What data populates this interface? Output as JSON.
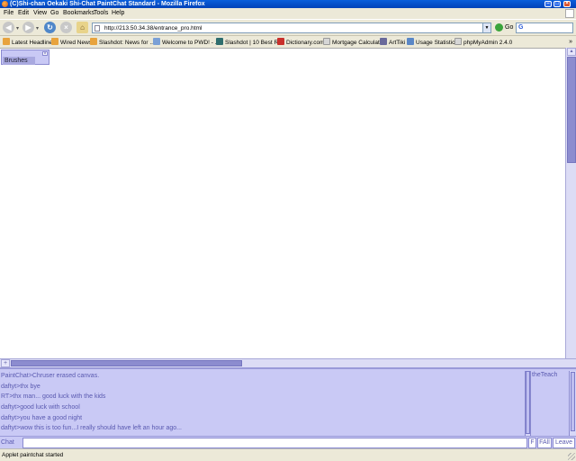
{
  "window": {
    "title": "(C)Shi-chan Oekaki Shi-Chat PaintChat Standard - Mozilla Firefox"
  },
  "menu": [
    "File",
    "Edit",
    "View",
    "Go",
    "Bookmarks",
    "Tools",
    "Help"
  ],
  "nav": {
    "url": "http://213.50.34.38/entrance_pro.html",
    "go_label": "Go",
    "search_value": ""
  },
  "bookmarks": [
    {
      "label": "Latest Headlines",
      "icon": "rss-icon",
      "color": "#e8a33d"
    },
    {
      "label": "Wired News",
      "icon": "rss-icon",
      "color": "#e8a33d"
    },
    {
      "label": "Slashdot: News for ...",
      "icon": "rss-icon",
      "color": "#e8a33d"
    },
    {
      "label": "Welcome to PWD! - ...",
      "icon": "page-icon",
      "color": "#7ba0d6"
    },
    {
      "label": "Slashdot | 10 Best R...",
      "icon": "slashdot-icon",
      "color": "#2f6e6e"
    },
    {
      "label": "Dictionary.com",
      "icon": "dictionary-icon",
      "color": "#c9302c"
    },
    {
      "label": "Mortgage Calculator",
      "icon": "page-icon",
      "color": "#d6d6d6"
    },
    {
      "label": "ArtTiki",
      "icon": "arttiki-icon",
      "color": "#6a6a9a"
    },
    {
      "label": "Usage Statistics",
      "icon": "stats-icon",
      "color": "#5b87c6"
    },
    {
      "label": "phpMyAdmin 2.4.0",
      "icon": "page-icon",
      "color": "#d6d6d6"
    }
  ],
  "brushes": {
    "label": "Brushes"
  },
  "chat": {
    "lines": [
      "PaintChat>Chruser erased canvas.",
      "daftyt>thx bye",
      "RT>thx man... good luck with the kids",
      "daftyt>good luck with school",
      "daftyt>you have a good night",
      "daftyt>wow this is too fun...I really should have left an hour ago..."
    ],
    "users": [
      "theTeach"
    ],
    "input_label": "Chat",
    "input_value": "",
    "buttons": {
      "f": "F",
      "fall": "FAll",
      "leave": "Leave"
    }
  },
  "status": {
    "text": "Applet paintchat started"
  },
  "colors": {
    "accent": "#c9c9f5",
    "chat_text": "#5a5ab0",
    "titlebar": "#0a5fdc"
  }
}
